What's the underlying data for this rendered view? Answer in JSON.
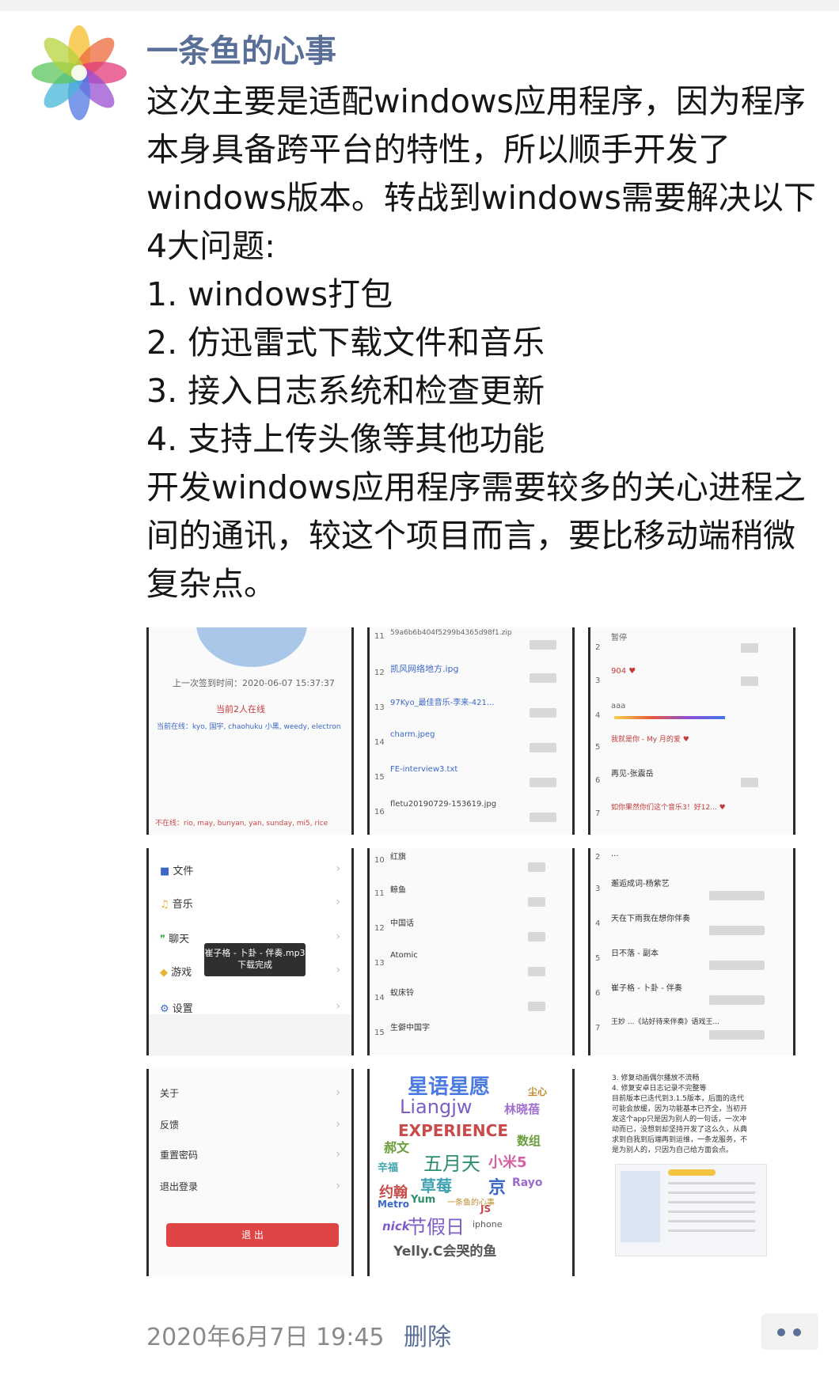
{
  "post": {
    "author": "一条鱼的心事",
    "paragraphs": [
      "这次主要是适配windows应用程序，因为程序本身具备跨平台的特性，所以顺手开发了windows版本。转战到windows需要解决以下4大问题:",
      "1. windows打包",
      "2. 仿迅雷式下载文件和音乐",
      "3. 接入日志系统和检查更新",
      "4. 支持上传头像等其他功能",
      "开发windows应用程序需要较多的关心进程之间的通讯，较这个项目而言，要比移动端稍微复杂点。"
    ],
    "time": "2020年6月7日 19:45",
    "delete_label": "删除"
  },
  "grid": {
    "cell1": {
      "signin_time": "上一次签到时间：2020-06-07 15:37:37",
      "today_signin": "当前2人在线",
      "online_list": "当前在线：kyo, 国宇, chaohuku 小黑, weedy, electron",
      "bottom_list": "不在线：rio, may, bunyan, yan, sunday, mi5, rice"
    },
    "cell2": {
      "items": [
        {
          "num": "11",
          "name": "59a6b6b404f5299b4365d98f1.zip"
        },
        {
          "num": "12",
          "name": "凯风网络地方.ipg"
        },
        {
          "num": "13",
          "name": "97Kyo_最佳音乐-李来-421..."
        },
        {
          "num": "14",
          "name": "charm.jpeg"
        },
        {
          "num": "15",
          "name": "FE-interview3.txt"
        },
        {
          "num": "16",
          "name": "fletu20190729-153619.jpg"
        }
      ]
    },
    "cell3": {
      "items": [
        {
          "num": "2",
          "name": "暂停"
        },
        {
          "num": "3",
          "name": "904 ♥"
        },
        {
          "num": "4",
          "name": "aaa"
        },
        {
          "num": "5",
          "name": "我就是你 - My 月的爱 ♥"
        },
        {
          "num": "6",
          "name": "再见-张震岳"
        },
        {
          "num": "7",
          "name": "如你果然你们这个音乐3！好12... ♥"
        }
      ]
    },
    "cell4": {
      "menu": [
        "文件",
        "音乐",
        "聊天",
        "游戏",
        "设置"
      ],
      "toast": "崔子格 - 卜卦 - 伴奏.mp3下载完成"
    },
    "cell5": {
      "items": [
        {
          "num": "10",
          "name": "红旗"
        },
        {
          "num": "11",
          "name": "鲸鱼"
        },
        {
          "num": "12",
          "name": "中国话"
        },
        {
          "num": "13",
          "name": "Atomic"
        },
        {
          "num": "14",
          "name": "蚁床铃"
        },
        {
          "num": "15",
          "name": "生僻中国字"
        }
      ]
    },
    "cell6": {
      "items": [
        {
          "num": "2",
          "name": "..."
        },
        {
          "num": "3",
          "name": "邂逅成词-杨紫艺"
        },
        {
          "num": "4",
          "name": "天在下雨我在想你伴奏"
        },
        {
          "num": "5",
          "name": "日不落 - 副本"
        },
        {
          "num": "6",
          "name": "崔子格 - 卜卦 - 伴奏"
        },
        {
          "num": "7",
          "name": "王妙 ...《站好待来伴奏》语戏王..."
        }
      ]
    },
    "cell7": {
      "menu": [
        "关于",
        "反馈",
        "重置密码",
        "退出登录"
      ],
      "logout": "退 出"
    },
    "cell8": {
      "words": [
        "星语星愿",
        "Liangjw",
        "EXPERIENCE",
        "五月天",
        "小米5",
        "草莓",
        "京",
        "Rayo",
        "节假日",
        "Yelly.C会哭的鱼",
        "林晓蓓",
        "数组",
        "Metro",
        "Yum",
        "一条鱼的心事",
        "iphone",
        "JS",
        "约翰",
        "郝文",
        "辛福",
        "nick",
        "尘心"
      ]
    },
    "cell9": {
      "lines": [
        "3. 修复动画偶尔播放不流畅",
        "4. 修复安卓日志记录不完整等",
        "目前版本已迭代到3.1.5版本，后面的迭代",
        "可能会放缓，因为功能基本已齐全，当初开",
        "发这个app只是因为别人的一句话，一次冲",
        "动而已，没想到却坚持开发了这么久，从典",
        "求到自我到后端再到运维，一条龙服务，不",
        "是为别人的，只因为自己给方面会点。"
      ]
    }
  },
  "colors": {
    "name_blue": "#5a6f97",
    "time_gray": "#8a8a8a",
    "logout_red": "#e04545"
  }
}
